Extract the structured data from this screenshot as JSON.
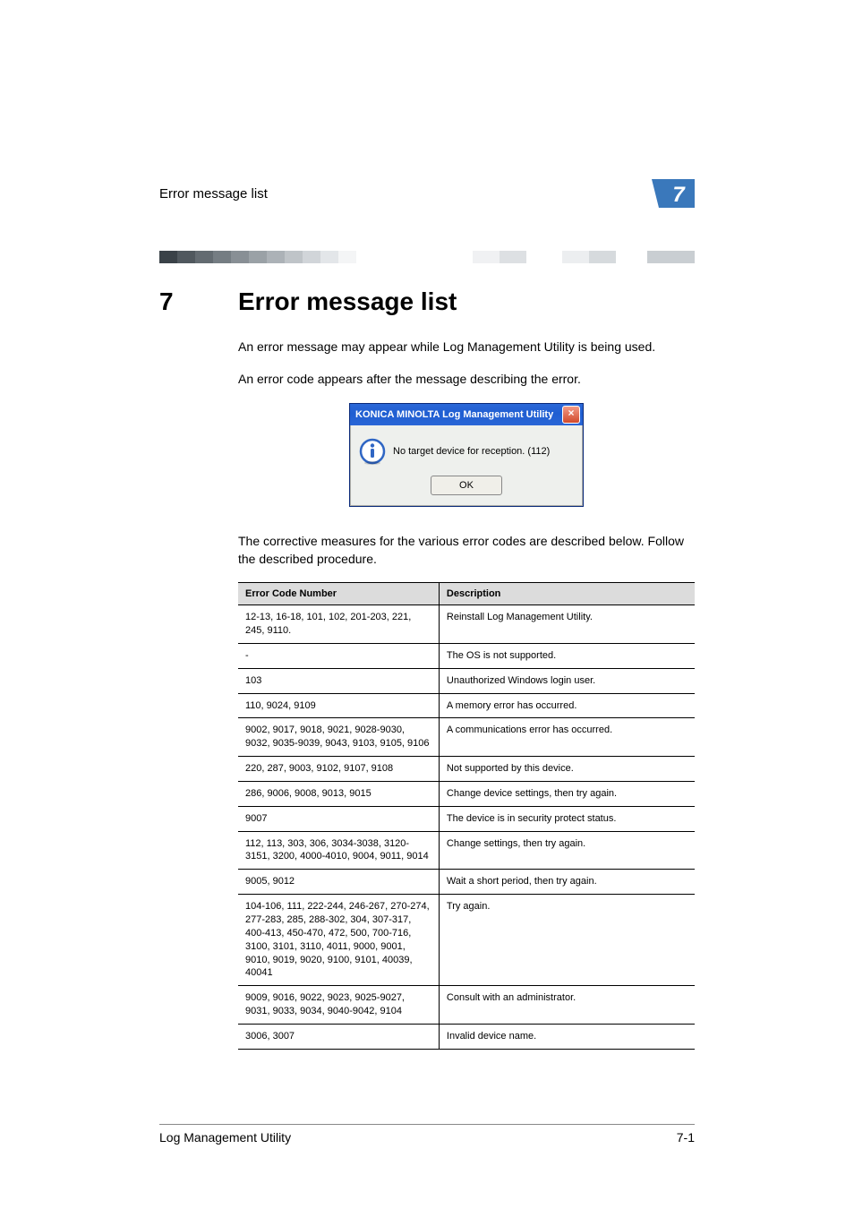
{
  "header": {
    "running_title": "Error message list",
    "chapter_number": "7"
  },
  "chapter": {
    "number": "7",
    "title": "Error message list"
  },
  "paragraphs": {
    "p1": "An error message may appear while Log Management Utility is being used.",
    "p2": "An error code appears after the message describing the error.",
    "p3": "The corrective measures for the various error codes are described below. Follow the described procedure."
  },
  "dialog": {
    "title": "KONICA MINOLTA Log Management Utility",
    "close_glyph": "×",
    "message": "No target device for reception. (112)",
    "ok": "OK"
  },
  "table": {
    "head_code": "Error Code Number",
    "head_desc": "Description",
    "rows": [
      {
        "code": "12-13, 16-18, 101, 102, 201-203, 221, 245, 9110.",
        "desc": "Reinstall Log Management Utility."
      },
      {
        "code": "-",
        "desc": "The OS is not supported."
      },
      {
        "code": "103",
        "desc": "Unauthorized Windows login user."
      },
      {
        "code": "110, 9024, 9109",
        "desc": "A memory error has occurred."
      },
      {
        "code": "9002, 9017, 9018, 9021, 9028-9030, 9032, 9035-9039, 9043, 9103, 9105, 9106",
        "desc": "A communications error has occurred."
      },
      {
        "code": "220, 287, 9003, 9102, 9107, 9108",
        "desc": "Not supported by this device."
      },
      {
        "code": "286, 9006, 9008, 9013, 9015",
        "desc": "Change device settings, then try again."
      },
      {
        "code": "9007",
        "desc": "The device is in security protect status."
      },
      {
        "code": "112, 113, 303, 306, 3034-3038, 3120-3151, 3200, 4000-4010, 9004, 9011, 9014",
        "desc": "Change settings, then try again."
      },
      {
        "code": "9005, 9012",
        "desc": "Wait a short period, then try again."
      },
      {
        "code": "104-106, 111, 222-244, 246-267, 270-274, 277-283, 285, 288-302, 304, 307-317, 400-413, 450-470, 472, 500, 700-716, 3100, 3101, 3110, 4011, 9000, 9001, 9010, 9019, 9020, 9100, 9101, 40039, 40041",
        "desc": "Try again."
      },
      {
        "code": "9009, 9016, 9022, 9023, 9025-9027, 9031, 9033, 9034, 9040-9042, 9104",
        "desc": "Consult with an administrator."
      },
      {
        "code": "3006, 3007",
        "desc": "Invalid device name."
      }
    ]
  },
  "footer": {
    "product": "Log Management Utility",
    "page": "7-1"
  }
}
